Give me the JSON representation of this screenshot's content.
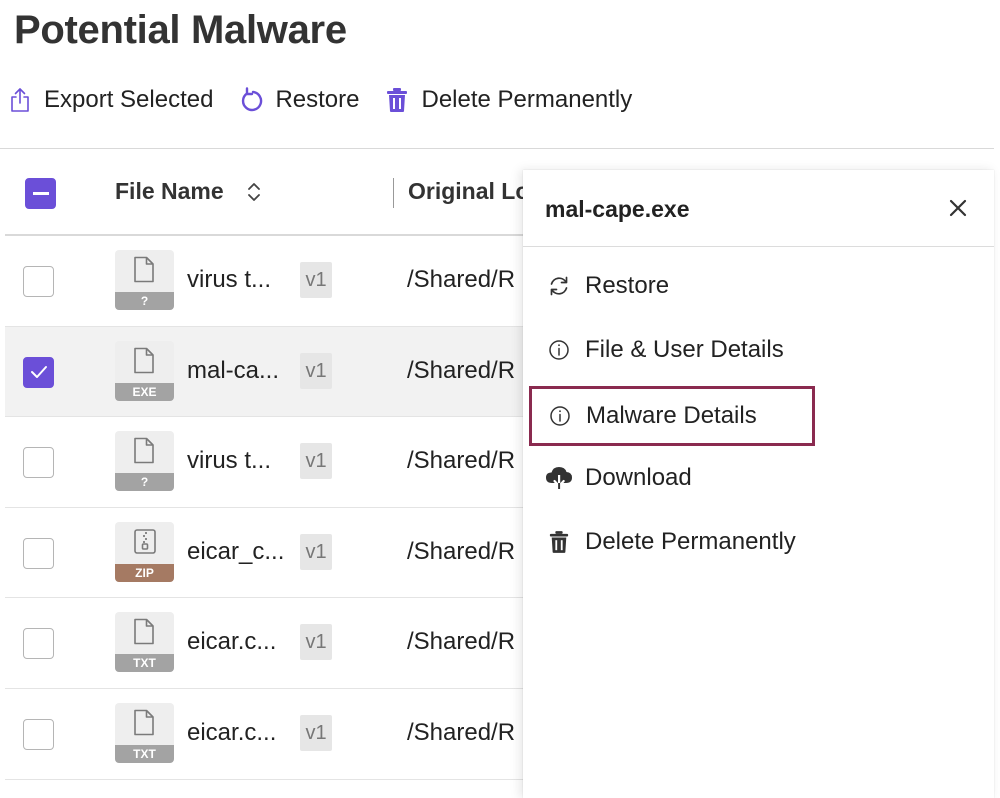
{
  "page": {
    "title": "Potential Malware"
  },
  "toolbar": {
    "export_label": "Export Selected",
    "restore_label": "Restore",
    "delete_label": "Delete Permanently"
  },
  "table": {
    "columns": {
      "file_name": "File Name",
      "original_location": "Original Lo"
    },
    "rows": [
      {
        "name": "virus t...",
        "ext": "?",
        "version": "v1",
        "location": "/Shared/R",
        "checked": false
      },
      {
        "name": "mal-ca...",
        "ext": "EXE",
        "version": "v1",
        "location": "/Shared/R",
        "checked": true
      },
      {
        "name": "virus t...",
        "ext": "?",
        "version": "v1",
        "location": "/Shared/R",
        "checked": false
      },
      {
        "name": "eicar_c...",
        "ext": "ZIP",
        "version": "v1",
        "location": "/Shared/R",
        "checked": false
      },
      {
        "name": "eicar.c...",
        "ext": "TXT",
        "version": "v1",
        "location": "/Shared/R",
        "checked": false
      },
      {
        "name": "eicar.c...",
        "ext": "TXT",
        "version": "v1",
        "location": "/Shared/R",
        "checked": false
      }
    ]
  },
  "panel": {
    "title": "mal-cape.exe",
    "menu": [
      {
        "label": "Restore",
        "icon": "restore-icon"
      },
      {
        "label": "File & User Details",
        "icon": "info-icon"
      },
      {
        "label": "Malware Details",
        "icon": "info-icon"
      },
      {
        "label": "Download",
        "icon": "cloud-download-icon"
      },
      {
        "label": "Delete Permanently",
        "icon": "trash-icon"
      }
    ]
  },
  "colors": {
    "accent": "#6b4fd8",
    "highlight_border": "#8a2a4f",
    "zip_badge": "#a57a63",
    "ext_badge": "#a3a3a3"
  }
}
